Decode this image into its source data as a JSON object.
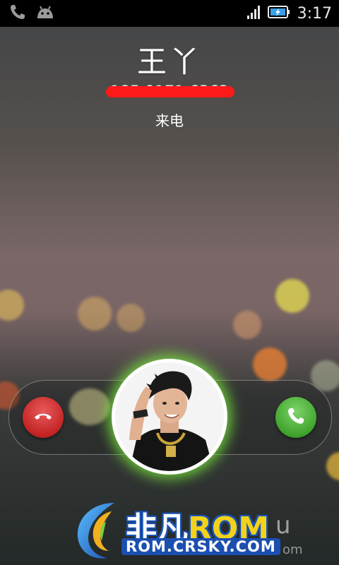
{
  "status_bar": {
    "time": "3:17",
    "icons": [
      "missed-call-icon",
      "android-icon",
      "signal-icon",
      "battery-charging-icon"
    ]
  },
  "call": {
    "caller_name": "王丫",
    "caller_number": "185 0171 6362",
    "state": "来电"
  },
  "controls": {
    "decline_icon": "decline-call-icon",
    "answer_icon": "answer-call-icon"
  },
  "watermark": {
    "brand_cn": "非凡",
    "brand_rom": "ROM",
    "suffix": "u",
    "url": "ROM.CRSKY.COM",
    "tail": "om"
  },
  "colors": {
    "decline": "#c42424",
    "answer": "#3fa42c",
    "glow": "#78e63c",
    "redaction": "#ff1a1a"
  }
}
